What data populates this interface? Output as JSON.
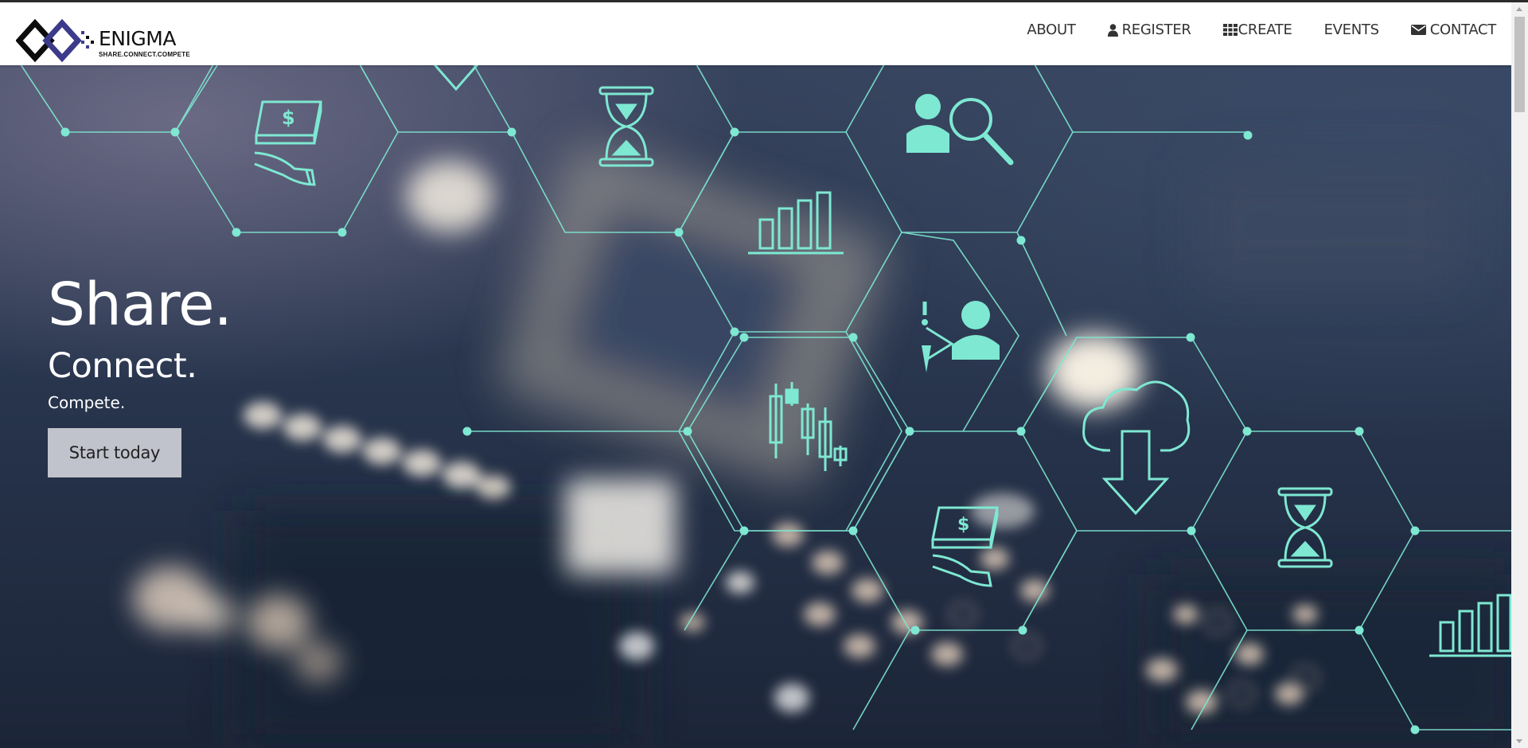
{
  "colors": {
    "accent": "#7ee8d2",
    "navbar_bg": "#ffffff",
    "nav_text": "#333333",
    "hero_text": "#ffffff",
    "button_bg": "#c1c3cc",
    "button_text": "#222222"
  },
  "brand": {
    "name": "ENIGMA",
    "tagline": "SHARE.CONNECT.COMPETE",
    "logo_icon": "diamond-logo-icon"
  },
  "nav": [
    {
      "label": "ABOUT",
      "icon": ""
    },
    {
      "label": "REGISTER",
      "icon": "user-icon"
    },
    {
      "label": "CREATE",
      "icon": "grid-icon"
    },
    {
      "label": "EVENTS",
      "icon": ""
    },
    {
      "label": "CONTACT",
      "icon": "envelope-icon"
    }
  ],
  "hero": {
    "line1": "Share.",
    "line2": "Connect.",
    "line3": "Compete.",
    "cta_label": "Start today",
    "background_icons": [
      "money-hand-icon",
      "hourglass-icon",
      "user-search-icon",
      "bar-chart-icon",
      "idea-user-icon",
      "candlestick-icon",
      "cloud-download-icon",
      "money-hand-icon",
      "hourglass-icon",
      "bar-chart-icon",
      "triangle-icon"
    ]
  }
}
